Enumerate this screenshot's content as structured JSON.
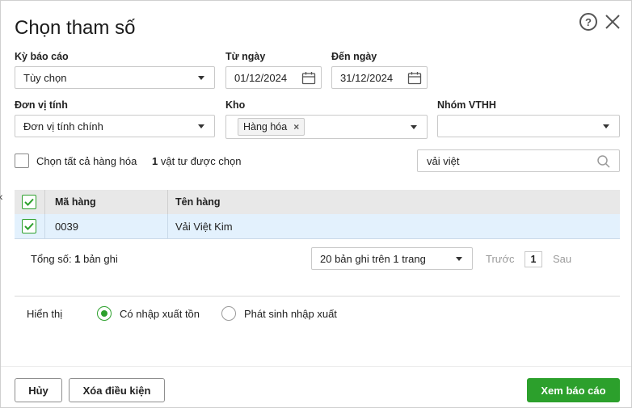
{
  "dialog": {
    "title": "Chọn tham số",
    "help_symbol": "?"
  },
  "report_period": {
    "label": "Kỳ báo cáo",
    "value": "Tùy chọn"
  },
  "from_date": {
    "label": "Từ ngày",
    "value": "01/12/2024"
  },
  "to_date": {
    "label": "Đến ngày",
    "value": "31/12/2024"
  },
  "unit": {
    "label": "Đơn vị tính",
    "value": "Đơn vị tính chính"
  },
  "warehouse": {
    "label": "Kho",
    "tags": [
      "Hàng hóa"
    ],
    "tag_remove_symbol": "×"
  },
  "item_group": {
    "label": "Nhóm VTHH",
    "value": ""
  },
  "select_all": {
    "label": "Chọn tất cả hàng hóa",
    "checked": false,
    "selected_count": "1",
    "selected_suffix": "vật tư được chọn"
  },
  "search": {
    "value": "vải việt"
  },
  "grid": {
    "columns": [
      "Mã hàng",
      "Tên hàng"
    ],
    "header_checked": true,
    "rows": [
      {
        "checked": true,
        "code": "0039",
        "name": "Vải Việt Kim"
      }
    ]
  },
  "pagination": {
    "total_label": "Tổng số:",
    "total_count": "1",
    "total_suffix": "bản ghi",
    "page_size": "20 bản ghi trên 1 trang",
    "prev": "Trước",
    "page": "1",
    "next": "Sau"
  },
  "display": {
    "label": "Hiển thị",
    "options": [
      {
        "label": "Có nhập xuất tồn",
        "selected": true
      },
      {
        "label": "Phát sinh nhập xuất",
        "selected": false
      }
    ]
  },
  "buttons": {
    "cancel": "Hủy",
    "clear": "Xóa điều kiện",
    "view": "Xem báo cáo"
  },
  "colors": {
    "accent": "#2ca02c",
    "selected_row": "#e3f1fd",
    "grid_header": "#e8e8e8"
  }
}
